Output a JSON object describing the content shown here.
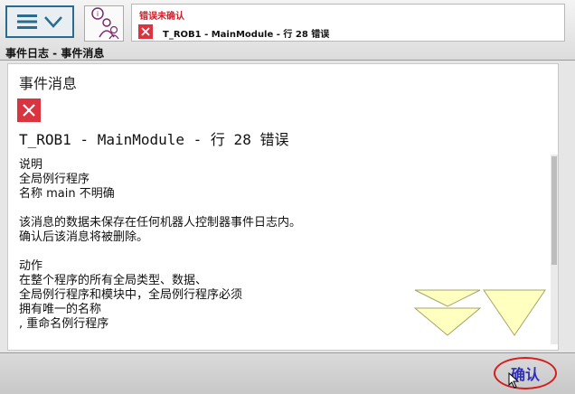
{
  "header": {
    "menu_icon": "hamburger-icon",
    "dropdown_icon": "chevron-down-icon",
    "event_log_icon": "event-log-icon",
    "breadcrumb": "事件日志 - 事件消息"
  },
  "alert": {
    "title": "错误未确认",
    "icon": "error-x-icon",
    "message": "T_ROB1 - MainModule - 行 28 错误"
  },
  "content": {
    "title": "事件消息",
    "error_icon": "error-x-icon",
    "error_line": "T_ROB1 - MainModule - 行 28 错误",
    "text": "说明\n全局例行程序\n名称 main 不明确\n\n该消息的数据未保存在任何机器人控制器事件日志内。\n确认后该消息将被删除。\n\n动作\n在整个程序的所有全局类型、数据、\n全局例行程序和模块中，全局例行程序必须\n拥有唯一的名称\n, 重命名例行程序"
  },
  "scroll": {
    "page_down_icon": "double-chevron-down-icon",
    "line_down_icon": "triangle-down-icon"
  },
  "footer": {
    "confirm_label": "确认"
  },
  "colors": {
    "accent_blue": "#2a6c8e",
    "error_red": "#d9343f",
    "confirm_text": "#2e2fb8",
    "scroll_yellow": "#ffffc0"
  }
}
